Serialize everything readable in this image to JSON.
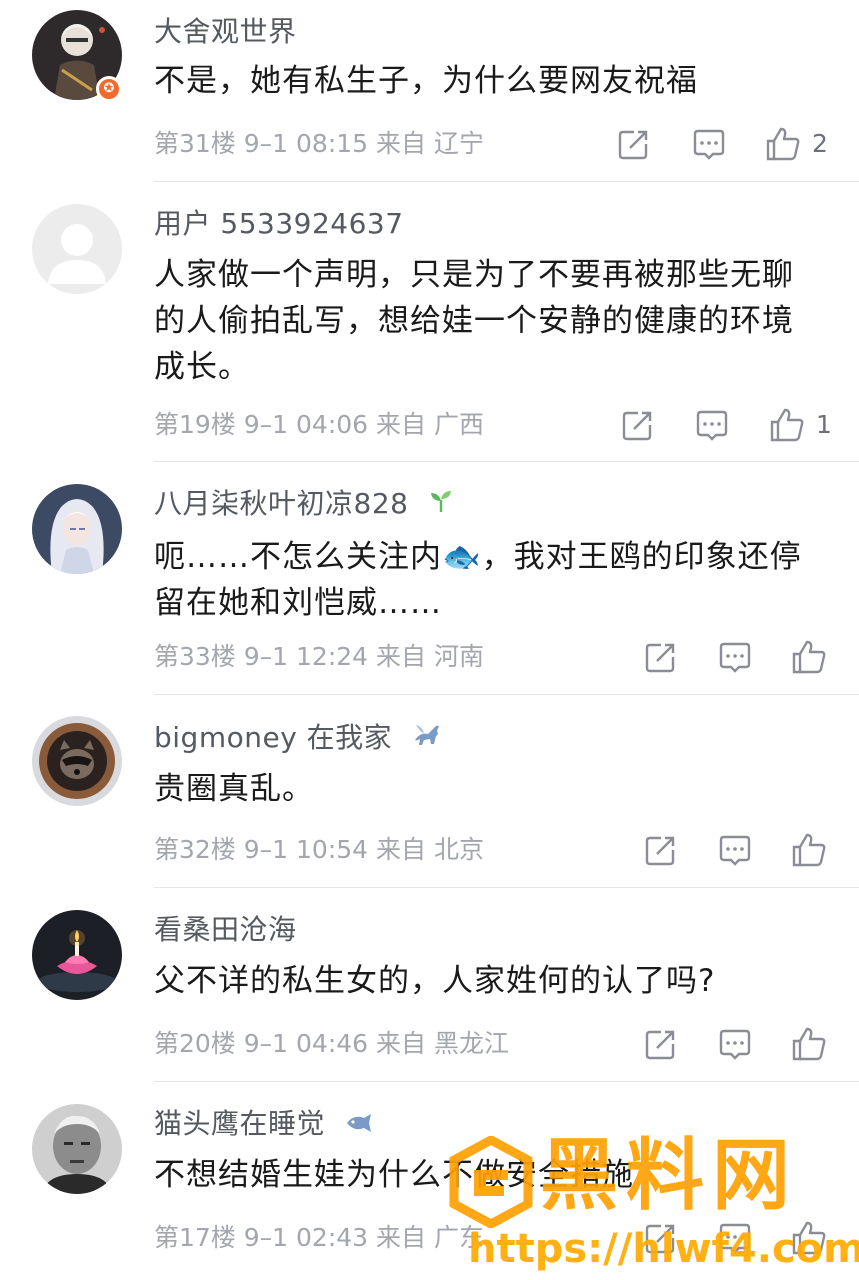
{
  "comments": [
    {
      "username": "大舍观世界",
      "content": "不是，她有私生子，为什么要网友祝福",
      "floor": "第31楼",
      "time": "9–1 08:15",
      "location": "来自 辽宁",
      "likes": "2",
      "name_icon": "",
      "avatar_icon": "cartoon-character-avatar-icon",
      "badge_icon": "star-badge-icon"
    },
    {
      "username": "用户 5533924637",
      "content": "人家做一个声明，只是为了不要再被那些无聊\n的人偷拍乱写，想给娃一个安静的健康的环境\n成长。",
      "floor": "第19楼",
      "time": "9–1 04:06",
      "location": "来自 广西",
      "likes": "1",
      "name_icon": "",
      "avatar_icon": "default-user-avatar-icon"
    },
    {
      "username": "八月柒秋叶初凉828",
      "content": "呃……不怎么关注内🐟，我对王鸥的印象还停\n留在她和刘恺威……",
      "floor": "第33楼",
      "time": "9–1 12:24",
      "location": "来自 河南",
      "likes": "",
      "name_icon": "sprout-icon",
      "avatar_icon": "anime-character-avatar-icon"
    },
    {
      "username": "bigmoney 在我家",
      "content": "贵圈真乱。",
      "floor": "第32楼",
      "time": "9–1 10:54",
      "location": "来自 北京",
      "likes": "",
      "name_icon": "pegasus-icon",
      "avatar_icon": "raccoon-avatar-icon"
    },
    {
      "username": "看桑田沧海",
      "content": "父不详的私生女的，人家姓何的认了吗?",
      "floor": "第20楼",
      "time": "9–1 04:46",
      "location": "来自 黑龙江",
      "likes": "",
      "name_icon": "",
      "avatar_icon": "lotus-candle-avatar-icon"
    },
    {
      "username": "猫头鹰在睡觉",
      "content": "不想结婚生娃为什么不做安全措施",
      "floor": "第17楼",
      "time": "9–1 02:43",
      "location": "来自 广东",
      "likes": "",
      "name_icon": "fish-icon",
      "avatar_icon": "elderly-man-photo-avatar-icon"
    }
  ],
  "actions": {
    "share_icon": "share-icon",
    "reply_icon": "comment-icon",
    "like_icon": "thumbs-up-icon"
  },
  "watermark": {
    "title": "黑料网",
    "url": "https://hlwf4.com"
  },
  "colors": {
    "text_primary": "#1a1a1a",
    "text_username": "#555a61",
    "text_meta": "#a3a7ad",
    "icon_gray": "#8a8e94",
    "divider": "#e4e5e7",
    "watermark_orange": "#ffa000"
  }
}
